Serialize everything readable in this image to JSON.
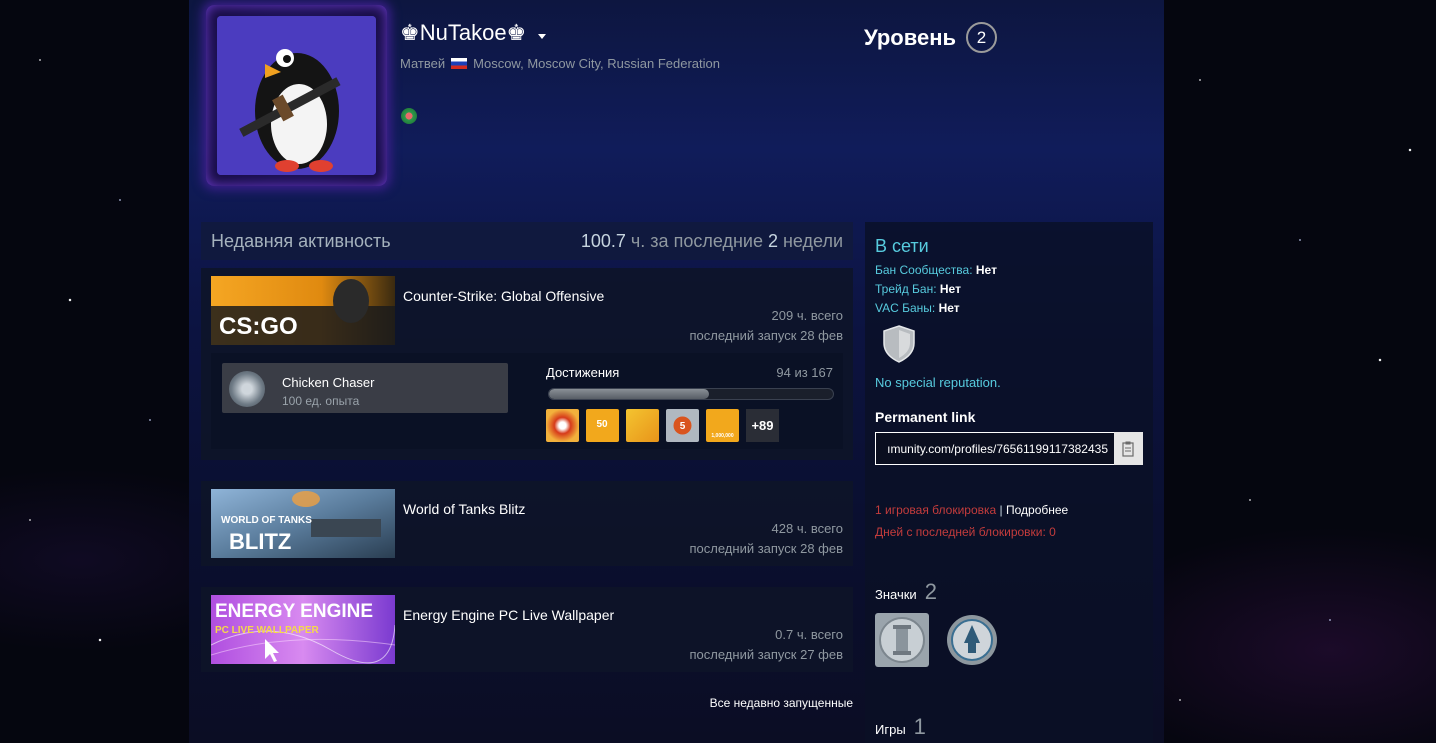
{
  "profile": {
    "persona_name": "♚NuTakoe♚",
    "real_name": "Матвей",
    "location": "Moscow, Moscow City, Russian Federation",
    "level_label": "Уровень",
    "level": "2"
  },
  "activity": {
    "title": "Недавняя активность",
    "hours_prefix": "100.7",
    "hours_mid": " ч. за последние ",
    "hours_weeks": "2",
    "hours_suffix": " недели",
    "all_recent_label": "Все недавно запущенные"
  },
  "games": [
    {
      "name": "Counter-Strike: Global Offensive",
      "hours": "209 ч. всего",
      "last_played": "последний запуск 28 фев",
      "capsule_text": "CS:GO"
    },
    {
      "name": "World of Tanks Blitz",
      "hours": "428 ч. всего",
      "last_played": "последний запуск 28 фев",
      "capsule_text_top": "WORLD OF TANKS",
      "capsule_text_bottom": "BLITZ"
    },
    {
      "name": "Energy Engine PC Live Wallpaper",
      "hours": "0.7 ч. всего",
      "last_played": "последний запуск 27 фев",
      "capsule_text_top": "ENERGY ENGINE",
      "capsule_text_bottom": "PC LIVE WALLPAPER"
    }
  ],
  "achievements": {
    "latest_name": "Chicken Chaser",
    "latest_xp": "100 ед. опыта",
    "title": "Достижения",
    "count": "94 из 167",
    "progress_fraction": 0.563,
    "icon_labels": [
      "50",
      "5",
      "1,000,000"
    ],
    "more": "+89"
  },
  "sidebar": {
    "status": "В сети",
    "community_ban_label": "Бан Сообщества: ",
    "community_ban_value": "Нет",
    "trade_ban_label": "Трейд Бан: ",
    "trade_ban_value": "Нет",
    "vac_ban_label": "VAC Баны: ",
    "vac_ban_value": "Нет",
    "reputation": "No special reputation.",
    "permanent_link_title": "Permanent link",
    "permanent_link_value": "ımunity.com/profiles/76561199117382435",
    "game_ban": "1 игровая блокировка",
    "game_ban_sep": " | ",
    "game_ban_more": "Подробнее",
    "days_since": "Дней с последней блокировки: 0",
    "badges_label": "Значки",
    "badges_count": "2",
    "games_label": "Игры",
    "games_count": "1"
  },
  "colors": {
    "accent_online": "#57cbde",
    "ban_red": "#c43c3c",
    "panel_bg": "#0d1640"
  }
}
